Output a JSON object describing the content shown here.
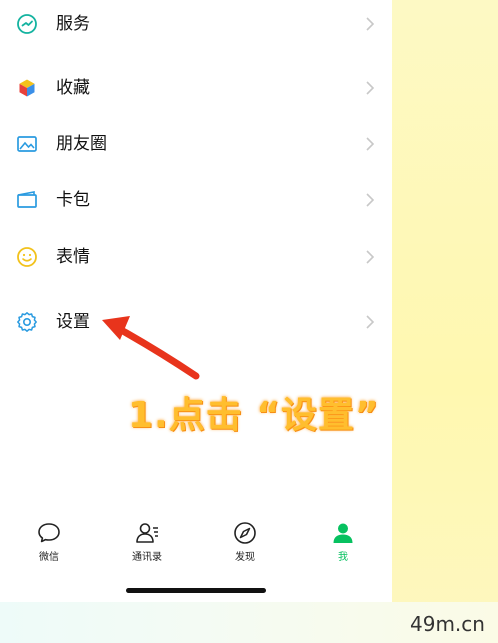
{
  "menu": {
    "items": [
      {
        "label": "服务",
        "icon": "service-icon"
      },
      {
        "label": "收藏",
        "icon": "favorites-cube-icon"
      },
      {
        "label": "朋友圈",
        "icon": "moments-image-icon"
      },
      {
        "label": "卡包",
        "icon": "card-wallet-icon"
      },
      {
        "label": "表情",
        "icon": "smiley-icon"
      },
      {
        "label": "设置",
        "icon": "gear-icon"
      }
    ]
  },
  "annotation": {
    "text": "1.点击 “设置”",
    "color": "#ffbe2e",
    "arrow_color": "#e8341c"
  },
  "tabbar": {
    "tabs": [
      {
        "label": "微信",
        "icon": "chat-bubble-icon",
        "active": false
      },
      {
        "label": "通讯录",
        "icon": "contacts-icon",
        "active": false
      },
      {
        "label": "发现",
        "icon": "compass-icon",
        "active": false
      },
      {
        "label": "我",
        "icon": "person-icon",
        "active": true
      }
    ],
    "active_color": "#07c160"
  },
  "watermark": "49m.cn"
}
